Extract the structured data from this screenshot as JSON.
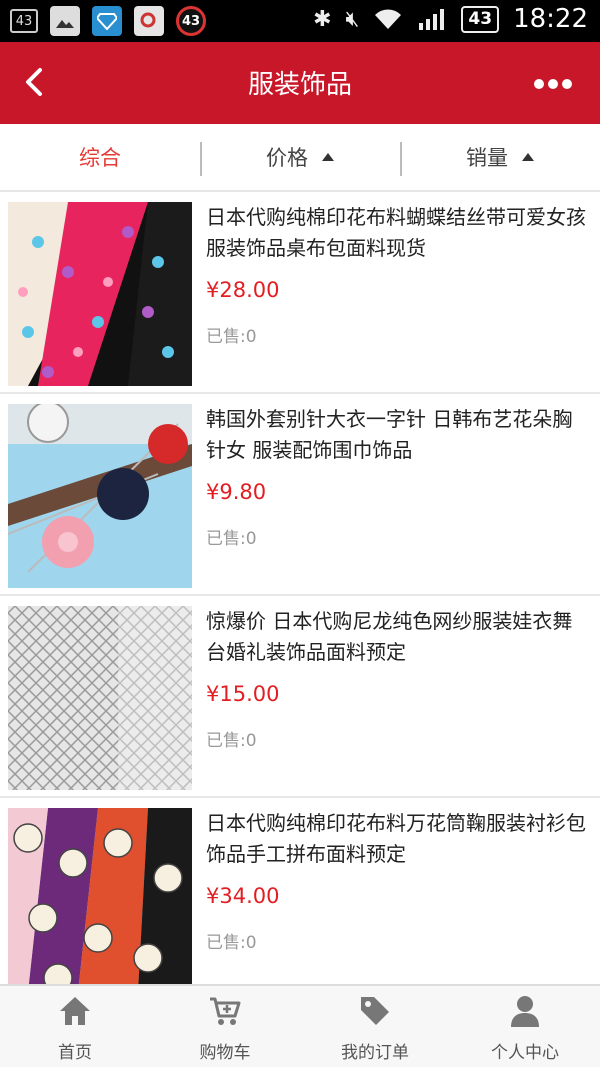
{
  "status_bar": {
    "notif_count": "43",
    "badge_count": "43",
    "battery": "43",
    "time": "18:22"
  },
  "header": {
    "title": "服装饰品"
  },
  "sort_tabs": [
    {
      "label": "综合",
      "active": true
    },
    {
      "label": "价格",
      "active": false
    },
    {
      "label": "销量",
      "active": false
    }
  ],
  "products": [
    {
      "name": "日本代购纯棉印花布料蝴蝶结丝带可爱女孩服装饰品桌布包面料现货",
      "price": "¥28.00",
      "sold": "已售:0"
    },
    {
      "name": "韩国外套别针大衣一字针 日韩布艺花朵胸针女 服装配饰围巾饰品",
      "price": "¥9.80",
      "sold": "已售:0"
    },
    {
      "name": "惊爆价 日本代购尼龙纯色网纱服装娃衣舞台婚礼装饰品面料预定",
      "price": "¥15.00",
      "sold": "已售:0"
    },
    {
      "name": "日本代购纯棉印花布料万花筒鞠服装衬衫包饰品手工拼布面料预定",
      "price": "¥34.00",
      "sold": "已售:0"
    }
  ],
  "tabbar": [
    {
      "label": "首页",
      "icon": "home-icon"
    },
    {
      "label": "购物车",
      "icon": "cart-icon"
    },
    {
      "label": "我的订单",
      "icon": "tag-icon"
    },
    {
      "label": "个人中心",
      "icon": "user-icon"
    }
  ],
  "colors": {
    "brand_red": "#c9172a",
    "price_red": "#e21e22",
    "active_tab": "#e53935"
  }
}
